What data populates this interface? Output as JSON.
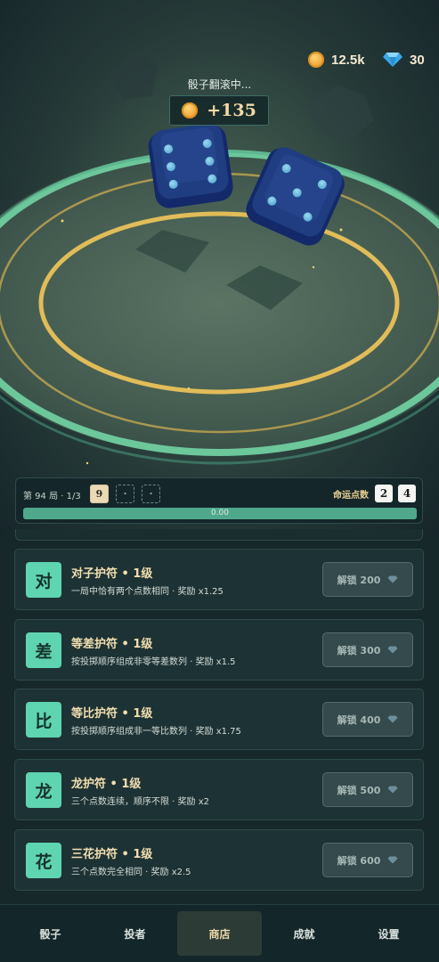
{
  "hud": {
    "coins": "12.5k",
    "gems": "30",
    "coin_icon": "coin-icon",
    "gem_icon": "diamond-icon"
  },
  "scene": {
    "status_text": "骰子翻滚中...",
    "reward_text": "+135",
    "dice": [
      {
        "face": 6,
        "color": "#1c3a78"
      },
      {
        "face": 5,
        "color": "#1c3a78"
      }
    ],
    "colors": {
      "inner_ring": "#e1bc58",
      "outer_ring": "#72d4a4"
    }
  },
  "round": {
    "label": "第 94 局 · 1/3",
    "slots": [
      "9",
      "·",
      "·"
    ],
    "fate_label": "命运点数",
    "fate_values": [
      "2",
      "4"
    ],
    "progress": 0.0,
    "progress_text": "0.00"
  },
  "charms": [
    {
      "icon_char": "对",
      "title": "对子护符 • 1级",
      "desc": "一局中恰有两个点数相同 · 奖励 x1.25",
      "button": "解锁 200"
    },
    {
      "icon_char": "差",
      "title": "等差护符 • 1级",
      "desc": "按投掷顺序组成非零等差数列 · 奖励 x1.5",
      "button": "解锁 300"
    },
    {
      "icon_char": "比",
      "title": "等比护符 • 1级",
      "desc": "按投掷顺序组成非一等比数列 · 奖励 x1.75",
      "button": "解锁 400"
    },
    {
      "icon_char": "龙",
      "title": "龙护符 • 1级",
      "desc": "三个点数连续，顺序不限 · 奖励 x2",
      "button": "解锁 500"
    },
    {
      "icon_char": "花",
      "title": "三花护符 • 1级",
      "desc": "三个点数完全相同 · 奖励 x2.5",
      "button": "解锁 600"
    }
  ],
  "nav": {
    "items": [
      "骰子",
      "投者",
      "商店",
      "成就",
      "设置"
    ],
    "active_index": 2
  },
  "colors": {
    "accent": "#5fd4b0",
    "title_gold": "#f2dfb0",
    "background": "#16282a"
  }
}
